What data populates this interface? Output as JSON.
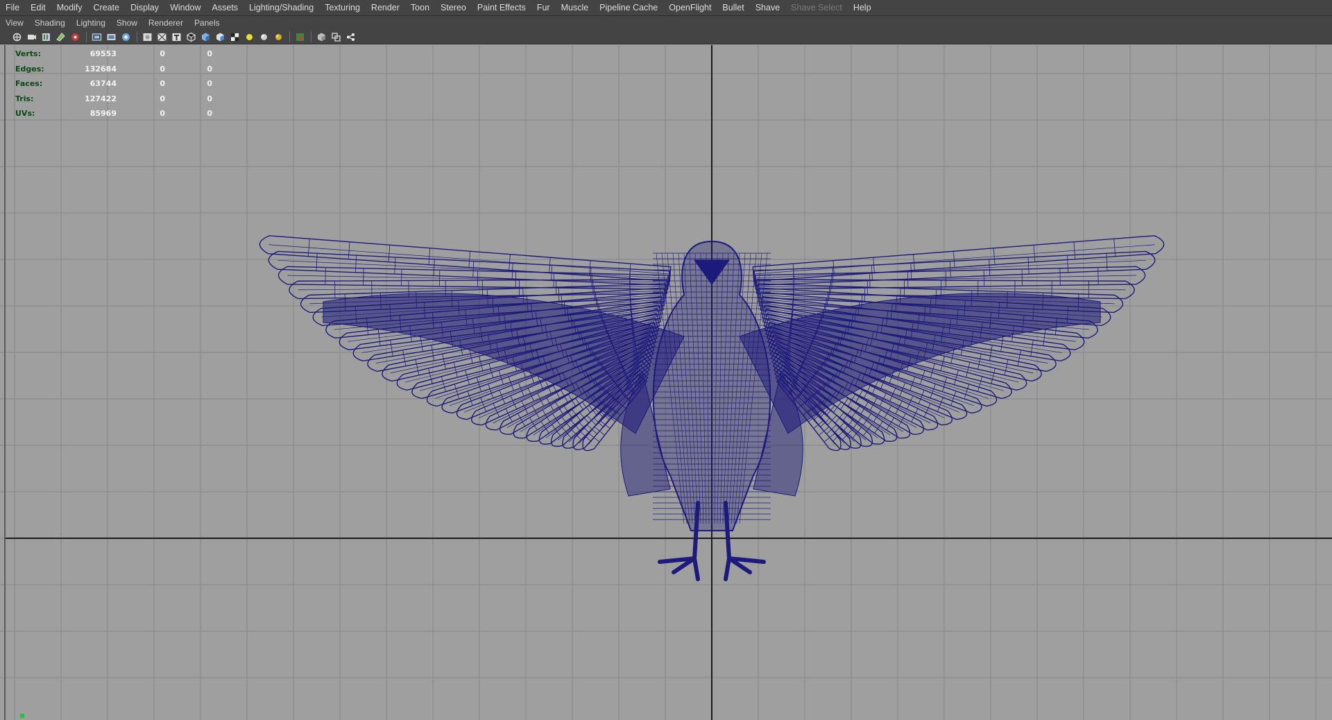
{
  "menubar": {
    "items": [
      "File",
      "Edit",
      "Modify",
      "Create",
      "Display",
      "Window",
      "Assets",
      "Lighting/Shading",
      "Texturing",
      "Render",
      "Toon",
      "Stereo",
      "Paint Effects",
      "Fur",
      "Muscle",
      "Pipeline Cache",
      "OpenFlight",
      "Bullet",
      "Shave",
      "Shave Select",
      "Help"
    ],
    "disabled": [
      "Shave Select"
    ]
  },
  "panel_menu": {
    "items": [
      "View",
      "Shading",
      "Lighting",
      "Show",
      "Renderer",
      "Panels"
    ]
  },
  "toolbar": {
    "icons": [
      "select-camera-icon",
      "camera-attributes-icon",
      "bookmarks-icon",
      "image-plane-icon",
      "grid-toggle-icon",
      "film-gate-icon",
      "resolution-gate-icon",
      "gate-mask-icon",
      "field-chart-icon",
      "safe-action-icon",
      "safe-title-icon",
      "wireframe-icon",
      "smooth-shade-icon",
      "flat-shade-icon",
      "textured-icon",
      "default-lighting-icon",
      "all-lights-icon",
      "shadows-icon",
      "isolate-select-icon",
      "xray-icon",
      "xray-joints-icon",
      "component-xray-icon"
    ]
  },
  "hud": {
    "rows": [
      {
        "label": "Verts:",
        "total": "69553",
        "selected": "0",
        "uv": "0"
      },
      {
        "label": "Edges:",
        "total": "132684",
        "selected": "0",
        "uv": "0"
      },
      {
        "label": "Faces:",
        "total": "63744",
        "selected": "0",
        "uv": "0"
      },
      {
        "label": "Tris:",
        "total": "127422",
        "selected": "0",
        "uv": "0"
      },
      {
        "label": "UVs:",
        "total": "85969",
        "selected": "0",
        "uv": "0"
      }
    ]
  },
  "colors": {
    "menubar_bg": "#444444",
    "viewport_bg": "#9f9f9f",
    "grid_line": "#858585",
    "axis_line": "#1a1a1a",
    "wireframe": "#1c1a7a",
    "hud_label": "#0a4a12",
    "hud_value": "#f3f3f3",
    "axis_indicator": "#23c23a"
  }
}
